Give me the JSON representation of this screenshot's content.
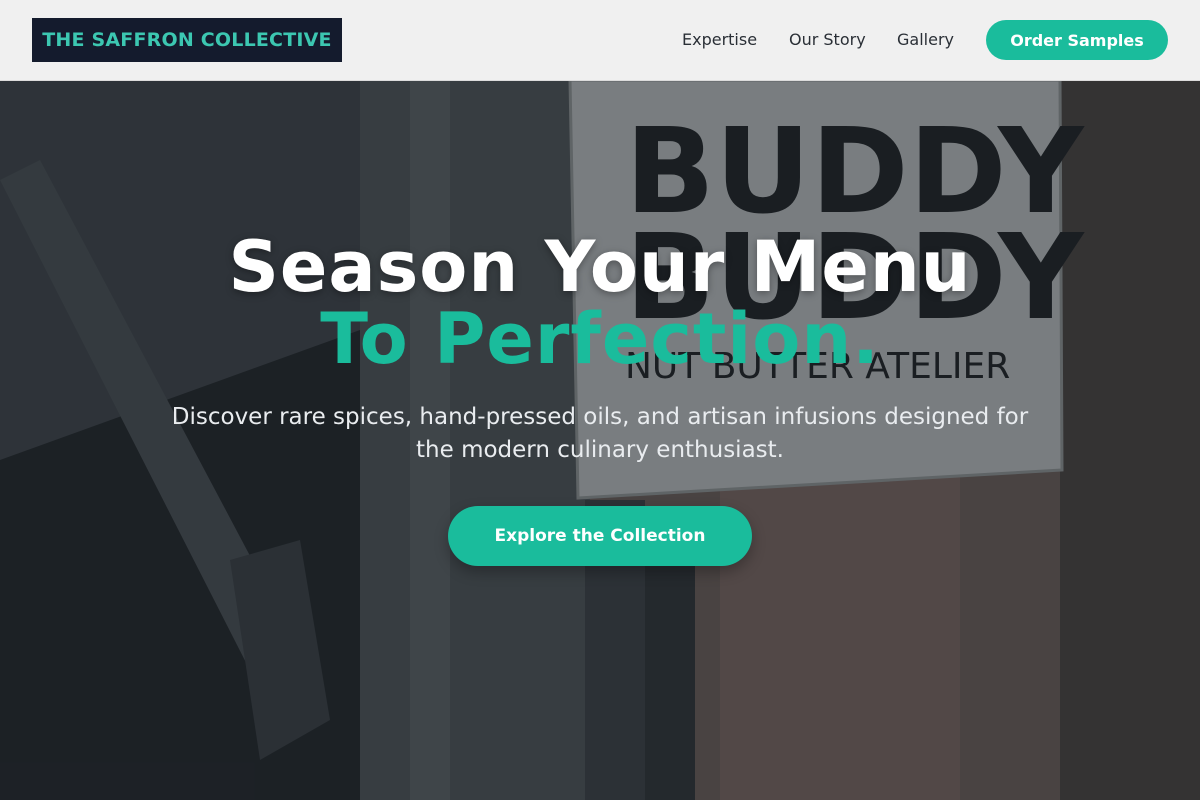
{
  "brand": {
    "name": "THE SAFFRON COLLECTIVE"
  },
  "nav": {
    "items": [
      {
        "label": "Expertise"
      },
      {
        "label": "Our Story"
      },
      {
        "label": "Gallery"
      }
    ],
    "cta_label": "Order Samples"
  },
  "hero": {
    "title": "Season Your Menu",
    "title_accent": "To Perfection.",
    "description": "Discover rare spices, hand-pressed oils, and artisan infusions designed for the modern culinary enthusiast.",
    "cta_label": "Explore the Collection"
  },
  "background_photo": {
    "sign_line1": "BUDDY",
    "sign_line2": "BUDDY",
    "sign_subtitle": "NUT BUTTER ATELIER"
  },
  "colors": {
    "accent": "#1abc9c",
    "brand_bg": "#141b2d",
    "brand_text": "#3cc7b1",
    "header_bg": "#f0f0f0"
  }
}
